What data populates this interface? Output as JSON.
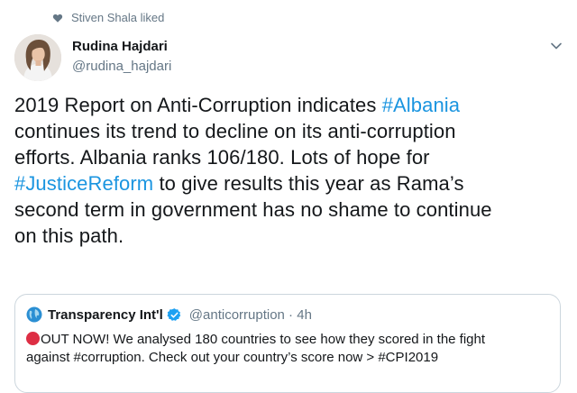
{
  "social_context": {
    "icon": "heart-icon",
    "text": "Stiven Shala liked"
  },
  "author": {
    "name": "Rudina Hajdari",
    "handle": "@rudina_hajdari"
  },
  "tweet": {
    "l1_text": "2019 Report on Anti-Corruption indicates ",
    "l1_tag": "#Albania",
    "l2": " continues its trend to decline on its anti-corruption",
    "l3": "efforts. Albania ranks 106/180.  Lots of hope for",
    "l4_tag": "#JusticeReform",
    "l4_text": " to give results this year as Rama’s",
    "l5": "second term in government has no shame to continue",
    "l6": "on this path."
  },
  "quote": {
    "name": "Transparency Int'l",
    "meta": "@anticorruption · 4h",
    "line1": "OUT NOW! We analysed 180 countries to see how they scored in the fight",
    "line2": "against #corruption. Check out your country’s score now > #CPI2019"
  },
  "colors": {
    "link": "#1b95e0",
    "secondary": "#657786",
    "verified": "#1da1f2"
  }
}
